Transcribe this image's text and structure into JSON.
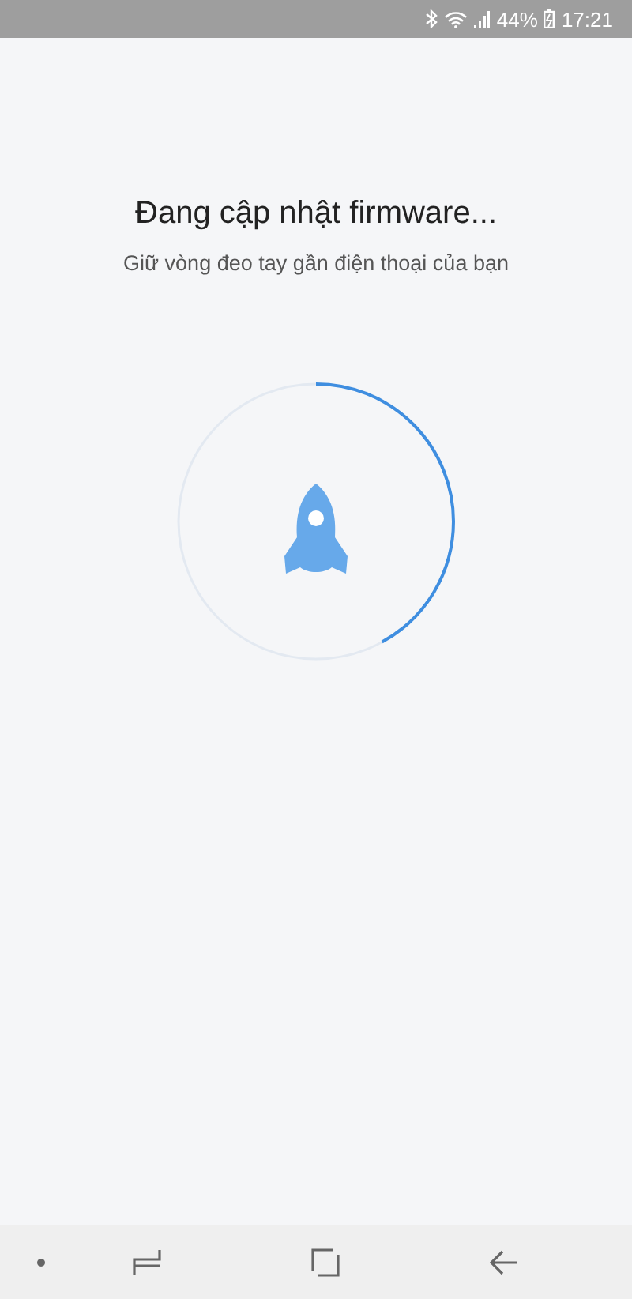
{
  "status_bar": {
    "battery": "44%",
    "time": "17:21"
  },
  "title": "Đang cập nhật firmware...",
  "subtitle": "Giữ vòng đeo tay gần điện thoại của bạn",
  "progress": {
    "level": 0.42
  }
}
